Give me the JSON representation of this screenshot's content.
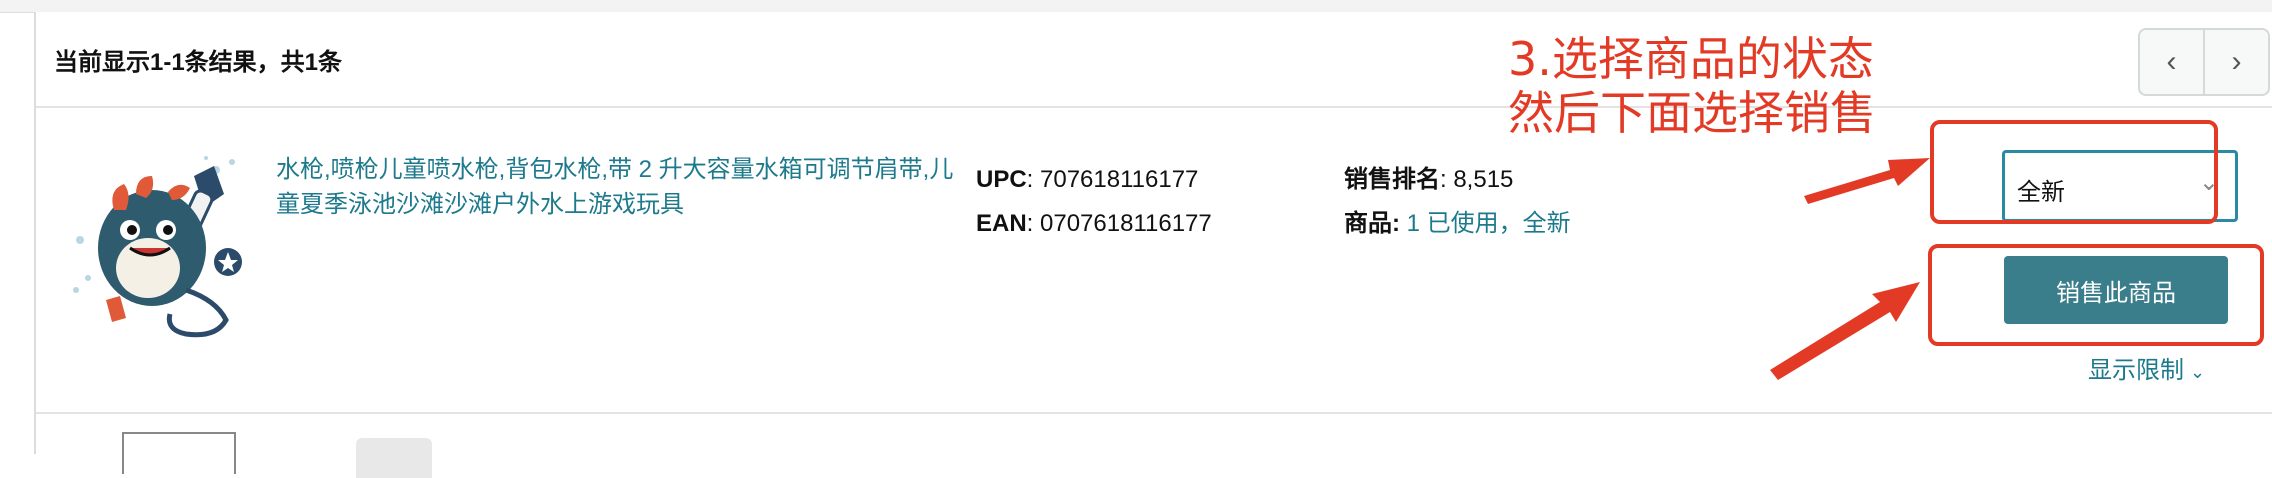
{
  "results": {
    "count_text": "当前显示1-1条结果，共1条",
    "pager": {
      "prev": "‹",
      "next": "›"
    }
  },
  "product": {
    "title": "水枪,喷枪儿童喷水枪,背包水枪,带 2 升大容量水箱可调节肩带,儿童夏季泳池沙滩沙滩户外水上游戏玩具",
    "upc_label": "UPC",
    "upc_value": ": 707618116177",
    "ean_label": "EAN",
    "ean_value": ": 0707618116177",
    "rank_label": "销售排名",
    "rank_value": ": 8,515",
    "offers_label": "商品: ",
    "offers_value": "1 已使用，全新",
    "condition_selected": "全新",
    "sell_button": "销售此商品",
    "show_restrictions": "显示限制"
  },
  "annotation": {
    "line1": "3.选择商品的状态",
    "line2": "然后下面选择销售",
    "color": "#e33a26"
  },
  "icons": [
    "chevron-left-icon",
    "chevron-right-icon",
    "chevron-down-icon"
  ]
}
